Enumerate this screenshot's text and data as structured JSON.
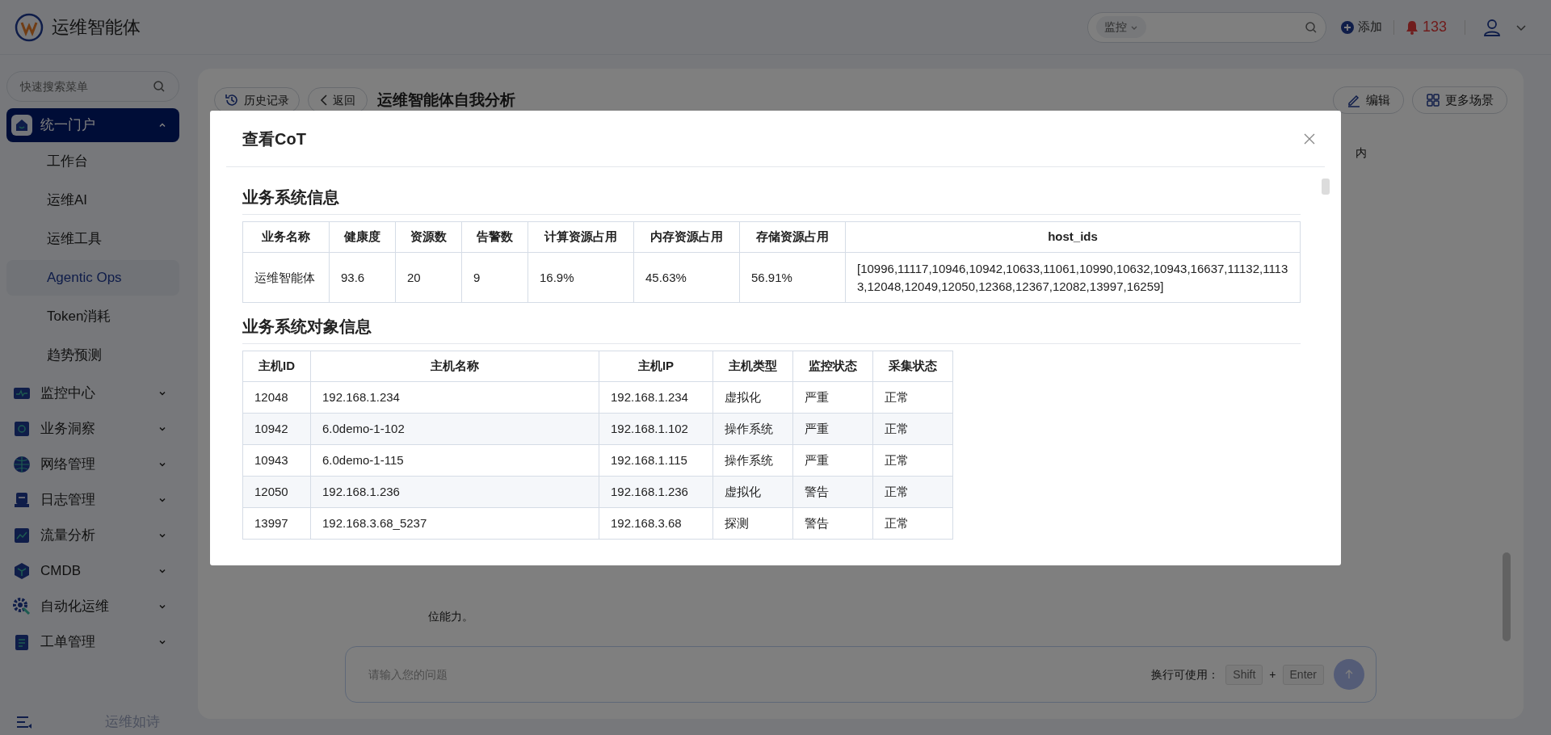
{
  "header": {
    "app_name": "运维智能体",
    "search": {
      "scope": "监控"
    },
    "add_label": "添加",
    "alert_count": "133"
  },
  "sidebar": {
    "search_placeholder": "快速搜索菜单",
    "items": [
      {
        "label": "统一门户",
        "expanded": true,
        "selected": true,
        "children": [
          {
            "label": "工作台",
            "selected": false
          },
          {
            "label": "运维AI",
            "selected": false
          },
          {
            "label": "运维工具",
            "selected": false
          },
          {
            "label": "Agentic Ops",
            "selected": true
          },
          {
            "label": "Token消耗",
            "selected": false
          },
          {
            "label": "趋势预测",
            "selected": false
          }
        ]
      },
      {
        "label": "监控中心",
        "expanded": false,
        "selected": false
      },
      {
        "label": "业务洞察",
        "expanded": false,
        "selected": false
      },
      {
        "label": "网络管理",
        "expanded": false,
        "selected": false
      },
      {
        "label": "日志管理",
        "expanded": false,
        "selected": false
      },
      {
        "label": "流量分析",
        "expanded": false,
        "selected": false
      },
      {
        "label": "CMDB",
        "expanded": false,
        "selected": false
      },
      {
        "label": "自动化运维",
        "expanded": false,
        "selected": false
      },
      {
        "label": "工单管理",
        "expanded": false,
        "selected": false
      }
    ],
    "footer": "运维如诗"
  },
  "main": {
    "history_button": "历史记录",
    "back_button": "返回",
    "title": "运维智能体自我分析",
    "edit_button": "编辑",
    "scenes_button": "更多场景",
    "chat_fragments": [
      "内",
      "位能力。"
    ],
    "input": {
      "placeholder": "请输入您的问题",
      "hint": "换行可使用：",
      "keys": [
        "Shift",
        "Enter"
      ],
      "plus": "+"
    }
  },
  "modal": {
    "title": "查看CoT",
    "sections": [
      {
        "heading": "业务系统信息",
        "table": {
          "columns": [
            "业务名称",
            "健康度",
            "资源数",
            "告警数",
            "计算资源占用",
            "内存资源占用",
            "存储资源占用",
            "host_ids"
          ],
          "rows": [
            [
              "运维智能体",
              "93.6",
              "20",
              "9",
              "16.9%",
              "45.63%",
              "56.91%",
              "[10996,11117,10946,10942,10633,11061,10990,10632,10943,16637,11132,11133,12048,12049,12050,12368,12367,12082,13997,16259]"
            ]
          ]
        }
      },
      {
        "heading": "业务系统对象信息",
        "table": {
          "columns": [
            "主机ID",
            "主机名称",
            "主机IP",
            "主机类型",
            "监控状态",
            "采集状态"
          ],
          "rows": [
            [
              "12048",
              "192.168.1.234",
              "192.168.1.234",
              "虚拟化",
              "严重",
              "正常"
            ],
            [
              "10942",
              "6.0demo-1-102",
              "192.168.1.102",
              "操作系统",
              "严重",
              "正常"
            ],
            [
              "10943",
              "6.0demo-1-115",
              "192.168.1.115",
              "操作系统",
              "严重",
              "正常"
            ],
            [
              "12050",
              "192.168.1.236",
              "192.168.1.236",
              "虚拟化",
              "警告",
              "正常"
            ],
            [
              "13997",
              "192.168.3.68_5237",
              "192.168.3.68",
              "探测",
              "警告",
              "正常"
            ]
          ]
        }
      }
    ]
  }
}
